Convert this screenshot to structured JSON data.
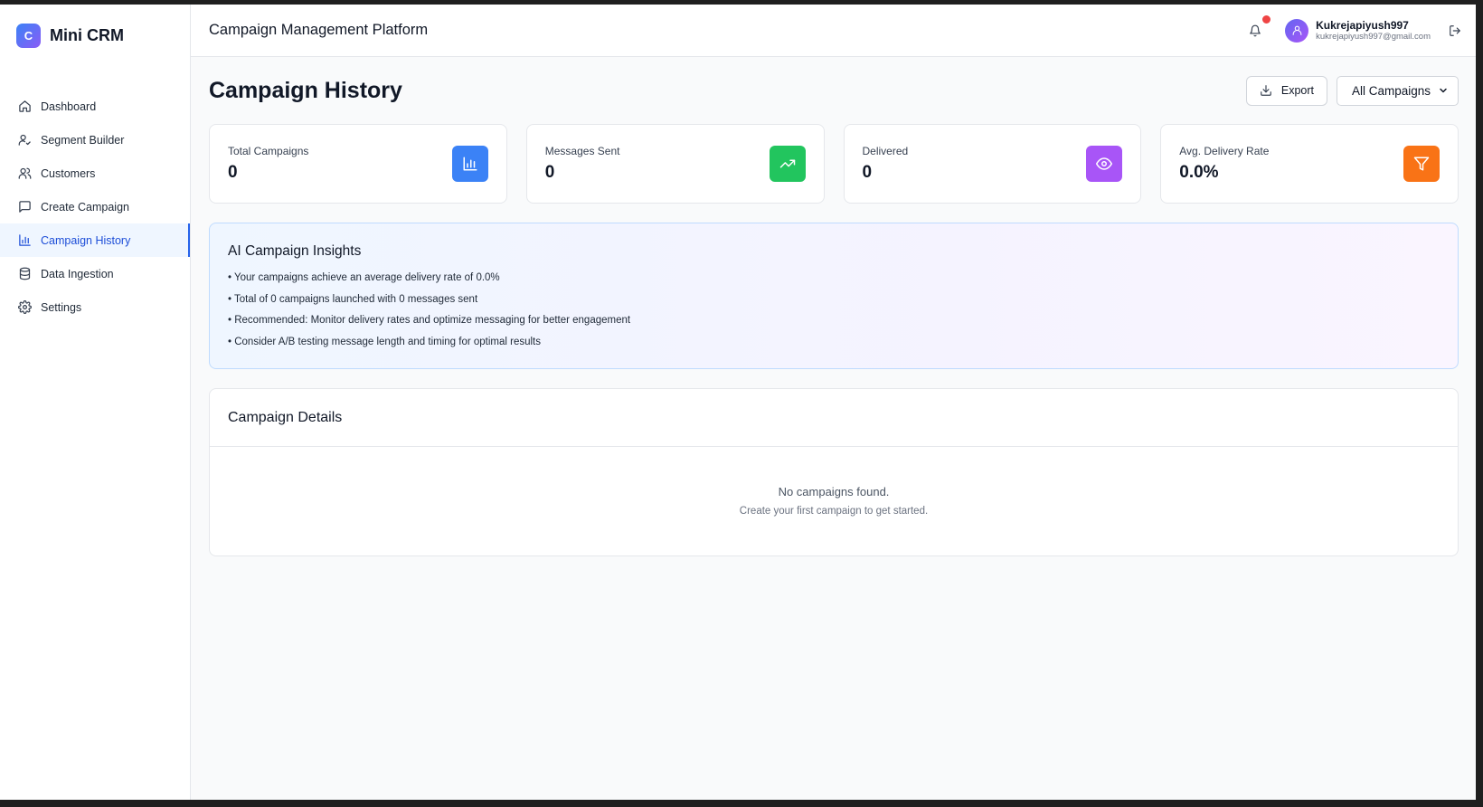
{
  "brand": {
    "logo_letter": "C",
    "name": "Mini CRM"
  },
  "sidebar": {
    "items": [
      {
        "label": "Dashboard",
        "icon": "home-icon"
      },
      {
        "label": "Segment Builder",
        "icon": "user-check-icon"
      },
      {
        "label": "Customers",
        "icon": "users-icon"
      },
      {
        "label": "Create Campaign",
        "icon": "message-square-icon"
      },
      {
        "label": "Campaign History",
        "icon": "bar-chart-icon",
        "active": true
      },
      {
        "label": "Data Ingestion",
        "icon": "database-icon"
      },
      {
        "label": "Settings",
        "icon": "gear-icon"
      }
    ]
  },
  "header": {
    "title": "Campaign Management Platform",
    "user_name": "Kukrejapiyush997",
    "user_email": "kukrejapiyush997@gmail.com"
  },
  "page": {
    "title": "Campaign History",
    "export_label": "Export",
    "filter_selected": "All Campaigns"
  },
  "stats": [
    {
      "label": "Total Campaigns",
      "value": "0",
      "icon": "bar-chart-icon",
      "color": "#3b82f6"
    },
    {
      "label": "Messages Sent",
      "value": "0",
      "icon": "trending-up-icon",
      "color": "#22c55e"
    },
    {
      "label": "Delivered",
      "value": "0",
      "icon": "eye-icon",
      "color": "#a855f7"
    },
    {
      "label": "Avg. Delivery Rate",
      "value": "0.0%",
      "icon": "filter-icon",
      "color": "#f97316"
    }
  ],
  "insights": {
    "title": "AI Campaign Insights",
    "items": [
      "• Your campaigns achieve an average delivery rate of 0.0%",
      "• Total of 0 campaigns launched with 0 messages sent",
      "• Recommended: Monitor delivery rates and optimize messaging for better engagement",
      "• Consider A/B testing message length and timing for optimal results"
    ]
  },
  "details": {
    "title": "Campaign Details",
    "empty_title": "No campaigns found.",
    "empty_subtitle": "Create your first campaign to get started."
  }
}
